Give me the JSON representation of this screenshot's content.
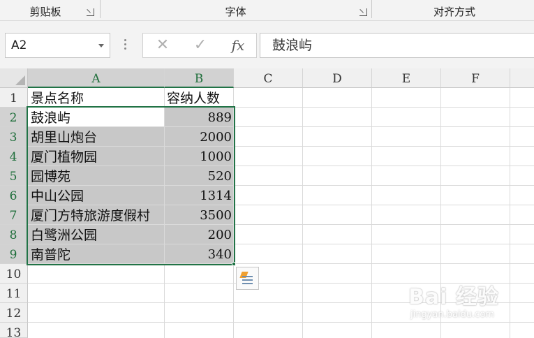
{
  "ribbon": {
    "groups": [
      {
        "label": "剪贴板"
      },
      {
        "label": "字体"
      },
      {
        "label": "对齐方式"
      }
    ]
  },
  "formula_bar": {
    "name_box": "A2",
    "cancel_symbol": "✕",
    "enter_symbol": "✓",
    "fx_label": "fx",
    "content": "鼓浪屿"
  },
  "sheet": {
    "columns": [
      "A",
      "B",
      "C",
      "D",
      "E",
      "F"
    ],
    "selected_columns": [
      "A",
      "B"
    ],
    "row_numbers": [
      "1",
      "2",
      "3",
      "4",
      "5",
      "6",
      "7",
      "8",
      "9",
      "10",
      "11",
      "12",
      "13"
    ],
    "selected_rows": [
      "2",
      "3",
      "4",
      "5",
      "6",
      "7",
      "8",
      "9"
    ],
    "header": {
      "a": "景点名称",
      "b": "容纳人数"
    },
    "rows": [
      {
        "a": "鼓浪屿",
        "b": "889"
      },
      {
        "a": "胡里山炮台",
        "b": "2000"
      },
      {
        "a": "厦门植物园",
        "b": "1000"
      },
      {
        "a": "园博苑",
        "b": "520"
      },
      {
        "a": "中山公园",
        "b": "1314"
      },
      {
        "a": "厦门方特旅游度假村",
        "b": "3500"
      },
      {
        "a": "白鹭洲公园",
        "b": "200"
      },
      {
        "a": "南普陀",
        "b": "340"
      }
    ],
    "selection_range": "A2:B9",
    "quick_analysis_icon": "quick-analysis-icon"
  },
  "watermark": {
    "text": "Bai 经验",
    "sub": "jingyan.baidu.com"
  },
  "colors": {
    "accent": "#217346",
    "selection_shade": "#c8c8c8",
    "header_bg": "#f0f0f0"
  }
}
